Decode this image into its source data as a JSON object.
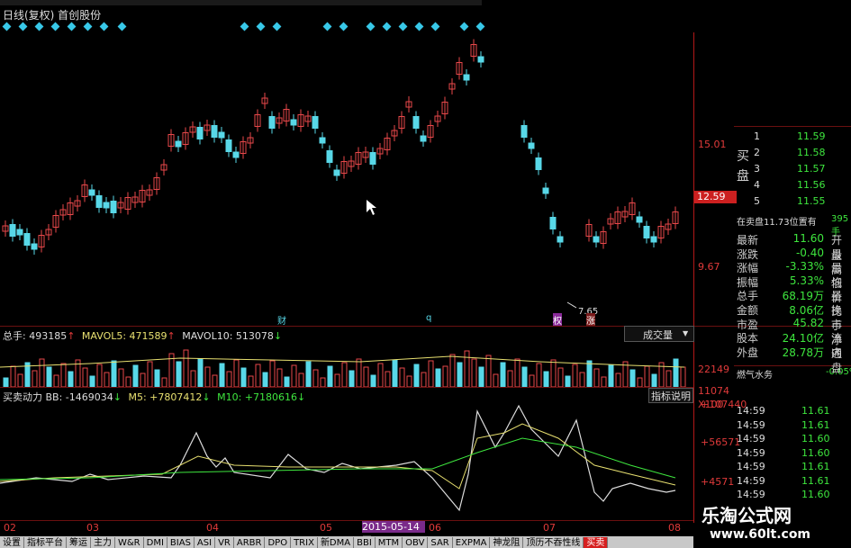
{
  "title": "日线(复权)  首创股份",
  "price_axis": {
    "high": "15.01",
    "last": "12.59",
    "low": "9.67",
    "min_label": "7.65"
  },
  "markers": {
    "m1": "财",
    "m2": "q",
    "m3": "权",
    "m4": "涨"
  },
  "volume": {
    "header_total": "总手: 493185",
    "header_ma5": "MAVOL5: 471589",
    "header_ma10": "MAVOL10: 513078",
    "select": "成交量",
    "axis_top": "22149",
    "axis_mid": "11074",
    "axis_unit": "X100"
  },
  "indicator": {
    "header_name": "买卖动力",
    "header_bb": "BB: -1469034",
    "header_m5": "M5: +7807412",
    "header_m10": "M10: +7180616",
    "button": "指标说明",
    "axis_top": "+107440",
    "axis_mid": "+56571",
    "axis_low": "+4571"
  },
  "dates": {
    "d02": "02",
    "d03": "03",
    "d04": "04",
    "d05": "05",
    "dsel": "2015-05-14四",
    "d06": "06",
    "d07": "07",
    "d08": "08"
  },
  "tabs": [
    "设置",
    "指标平台",
    "筹运",
    "主力",
    "W&R",
    "DMI",
    "BIAS",
    "ASI",
    "VR",
    "ARBR",
    "DPO",
    "TRIX",
    "新DMA",
    "BBI",
    "MTM",
    "OBV",
    "SAR",
    "EXPMA",
    "神龙阻",
    "顶历不吞性线",
    "买卖"
  ],
  "buy_panel": {
    "label": "买盘",
    "rows": [
      {
        "lv": "1",
        "price": "11.59"
      },
      {
        "lv": "2",
        "price": "11.58"
      },
      {
        "lv": "3",
        "price": "11.57"
      },
      {
        "lv": "4",
        "price": "11.56"
      },
      {
        "lv": "5",
        "price": "11.55"
      }
    ]
  },
  "order_line": {
    "text": "在卖盘11.73位置有",
    "qty": "395手"
  },
  "stats": [
    {
      "k": "最新",
      "v": "11.60",
      "k2": "开盘"
    },
    {
      "k": "涨跌",
      "v": "-0.40",
      "k2": "最高"
    },
    {
      "k": "涨幅",
      "v": "-3.33%",
      "k2": "最低"
    },
    {
      "k": "振幅",
      "v": "5.33%",
      "k2": "均价"
    },
    {
      "k": "总手",
      "v": "68.19万",
      "k2": "量比"
    },
    {
      "k": "金额",
      "v": "8.06亿",
      "k2": "换手"
    },
    {
      "k": "市盈",
      "v": "45.82",
      "k2": "市净"
    },
    {
      "k": "股本",
      "v": "24.10亿",
      "k2": "流通"
    },
    {
      "k": "外盘",
      "v": "28.78万",
      "k2": "内盘"
    }
  ],
  "sector": {
    "name": "燃气水务",
    "change": "-0.05%"
  },
  "trades": [
    {
      "t": "14:59",
      "p": "11.61"
    },
    {
      "t": "14:59",
      "p": "11.61"
    },
    {
      "t": "14:59",
      "p": "11.60"
    },
    {
      "t": "14:59",
      "p": "11.60"
    },
    {
      "t": "14:59",
      "p": "11.61"
    },
    {
      "t": "14:59",
      "p": "11.61"
    },
    {
      "t": "14:59",
      "p": "11.60"
    }
  ],
  "watermark": {
    "line1": "乐淘公式网",
    "line2": "www.60lt.com"
  },
  "colors": {
    "up": "#e8484a",
    "down": "#58d8e8",
    "green": "#3ee63e",
    "axis": "#b21818"
  }
}
